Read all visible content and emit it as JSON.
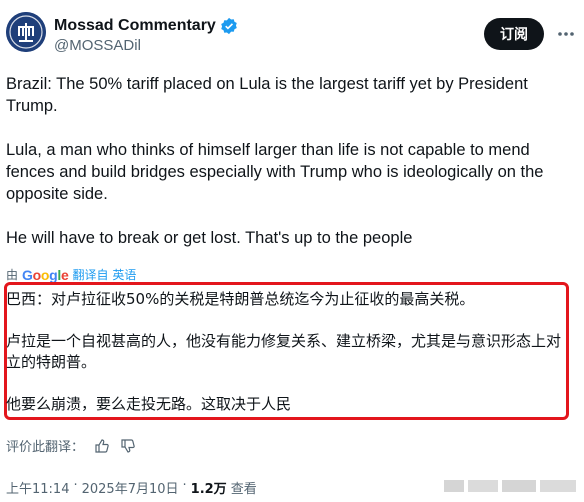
{
  "author": {
    "name": "Mossad Commentary",
    "handle": "@MOSSADil",
    "avatar_icon": "mossad-emblem-icon",
    "verified_icon": "verified-badge-icon"
  },
  "header": {
    "subscribe_label": "订阅",
    "more_icon": "more-options-icon"
  },
  "tweet": {
    "paragraphs": [
      "Brazil: The 50% tariff placed on Lula is the largest tariff yet by President Trump.",
      "Lula, a man who thinks of himself larger than life is not capable to mend fences and build bridges especially with Trump who is ideologically on the opposite side.",
      "He will have to break or get lost. That's up to the people"
    ]
  },
  "translation": {
    "by_label": "由",
    "provider": "Google",
    "link_label": "翻译自 英语",
    "paragraphs": [
      "巴西：对卢拉征收50%的关税是特朗普总统迄今为止征收的最高关税。",
      "卢拉是一个自视甚高的人，他没有能力修复关系、建立桥梁，尤其是与意识形态上对立的特朗普。",
      "他要么崩溃，要么走投无路。这取决于人民"
    ],
    "highlight_color": "#e3161c"
  },
  "rating": {
    "label": "评价此翻译：",
    "up_icon": "thumbs-up-icon",
    "down_icon": "thumbs-down-icon"
  },
  "footer": {
    "time": "上午11:14",
    "separator": "·",
    "date": "2025年7月10日",
    "views_count": "1.2万",
    "views_label": "查看"
  },
  "colors": {
    "accent": "#1d9bf0",
    "text": "#0f1419",
    "muted": "#536471"
  }
}
